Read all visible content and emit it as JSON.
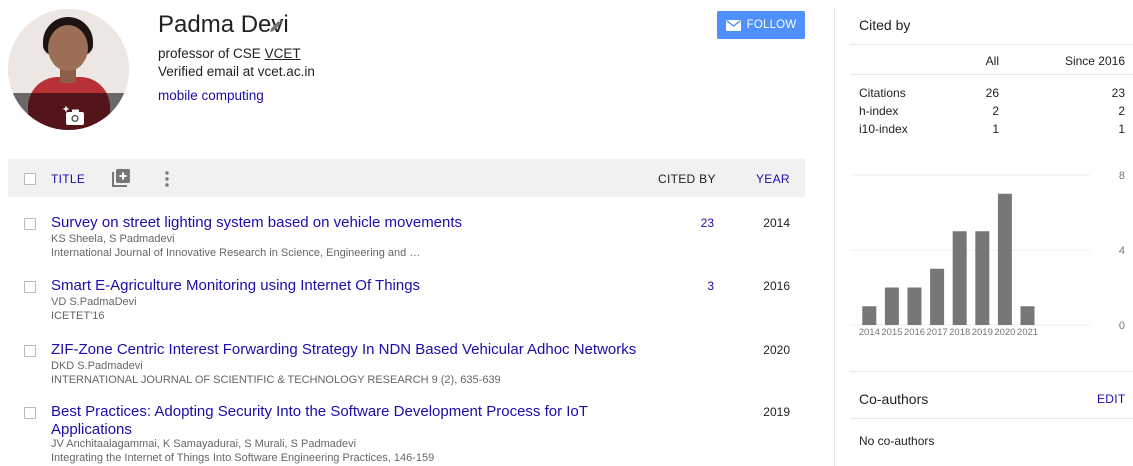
{
  "profile": {
    "name": "Padma Devi",
    "position": "professor of CSE",
    "institution": "VCET",
    "email_note": "Verified email at vcet.ac.in",
    "interest": "mobile computing",
    "follow_label": "FOLLOW"
  },
  "table": {
    "headers": {
      "title": "TITLE",
      "cited_by": "CITED BY",
      "year": "YEAR"
    },
    "rows": [
      {
        "title": "Survey on street lighting system based on vehicle movements",
        "authors": "KS Sheela, S Padmadevi",
        "venue": "International Journal of Innovative Research in Science, Engineering and …",
        "cited": "23",
        "year": "2014"
      },
      {
        "title": "Smart E-Agriculture Monitoring using Internet Of Things",
        "authors": "VD S.PadmaDevi",
        "venue": "ICETET'16",
        "cited": "3",
        "year": "2016"
      },
      {
        "title": "ZIF-Zone Centric Interest Forwarding Strategy In NDN Based Vehicular Adhoc Networks",
        "authors": "DKD S.Padmadevi",
        "venue": "INTERNATIONAL JOURNAL OF SCIENTIFIC & TECHNOLOGY RESEARCH 9 (2), 635-639",
        "cited": "",
        "year": "2020"
      },
      {
        "title": "Best Practices: Adopting Security Into the Software Development Process for IoT Applications",
        "authors": "JV Anchitaalagammai, K Samayadurai, S Murali, S Padmadevi",
        "venue": "Integrating the Internet of Things Into Software Engineering Practices, 146-159",
        "cited": "",
        "year": "2019"
      }
    ]
  },
  "cited_by": {
    "title": "Cited by",
    "columns": {
      "all": "All",
      "since": "Since 2016"
    },
    "rows": [
      {
        "label": "Citations",
        "all": "26",
        "since": "23"
      },
      {
        "label": "h-index",
        "all": "2",
        "since": "2"
      },
      {
        "label": "i10-index",
        "all": "1",
        "since": "1"
      }
    ]
  },
  "chart_data": {
    "type": "bar",
    "categories": [
      "2014",
      "2015",
      "2016",
      "2017",
      "2018",
      "2019",
      "2020",
      "2021"
    ],
    "values": [
      1,
      2,
      2,
      3,
      5,
      5,
      7,
      1
    ],
    "yticks": [
      "0",
      "4",
      "8"
    ],
    "ylim": [
      0,
      8
    ],
    "title": "",
    "xlabel": "",
    "ylabel": "",
    "bar_color": "#777777",
    "grid": true
  },
  "coauthors": {
    "title": "Co-authors",
    "edit_label": "EDIT",
    "empty_text": "No co-authors"
  },
  "colors": {
    "link": "#1a0dab",
    "button": "#4d90fe",
    "header_bg": "#f1f1f1"
  },
  "icons": {
    "edit": "pencil-icon",
    "photo": "add-photo-icon",
    "follow": "mail-icon",
    "add": "add-box-icon",
    "more": "more-vert-icon"
  }
}
